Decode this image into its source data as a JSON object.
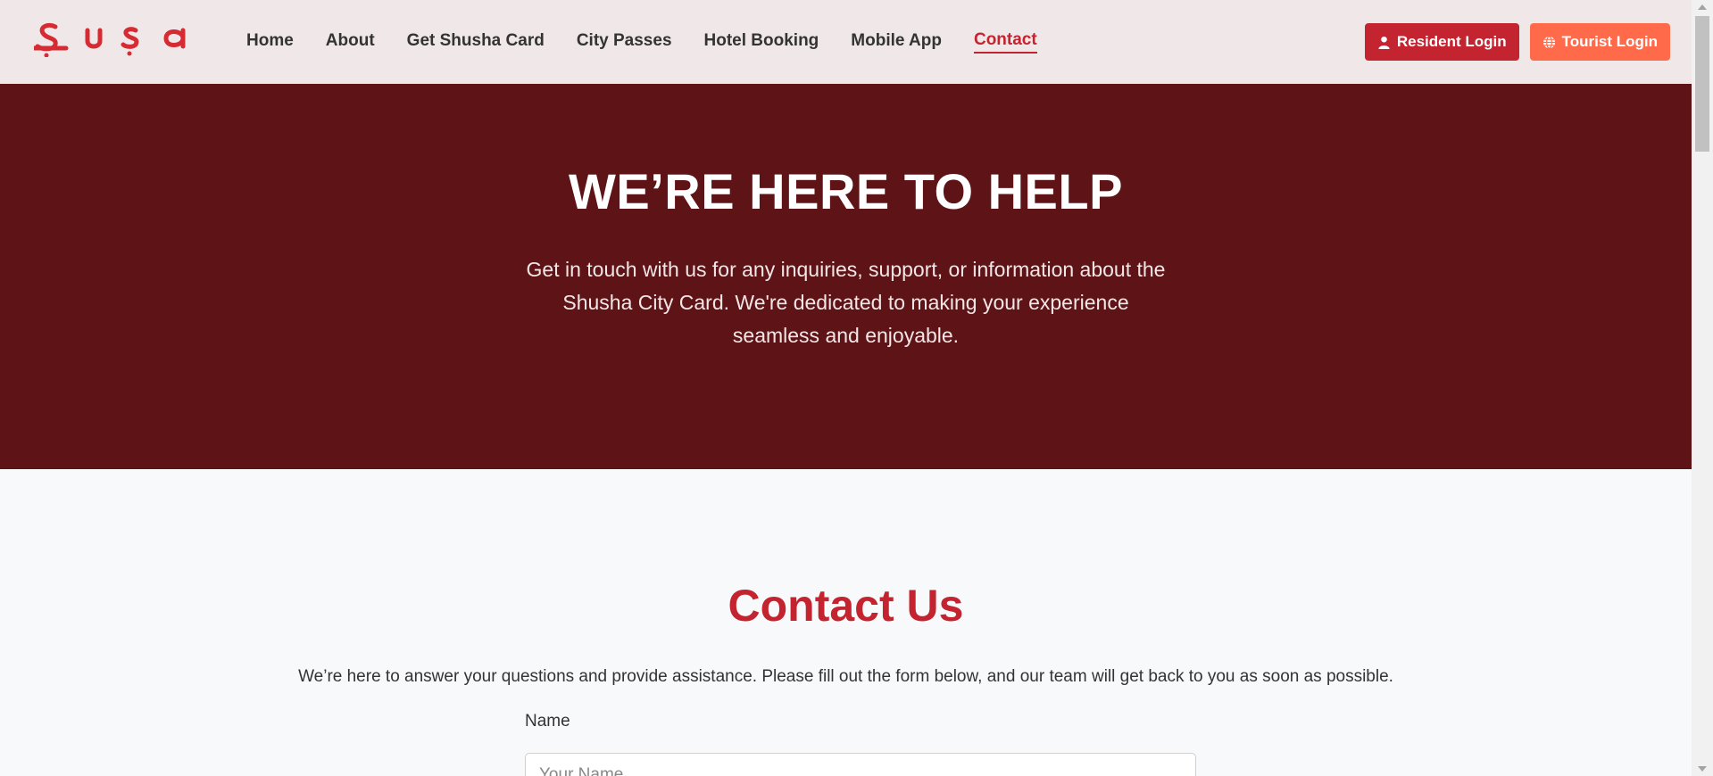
{
  "brand": {
    "logo_text": "Şuşa",
    "color": "#d62b33"
  },
  "nav": {
    "items": [
      {
        "label": "Home",
        "active": false
      },
      {
        "label": "About",
        "active": false
      },
      {
        "label": "Get Shusha Card",
        "active": false
      },
      {
        "label": "City Passes",
        "active": false
      },
      {
        "label": "Hotel Booking",
        "active": false
      },
      {
        "label": "Mobile App",
        "active": false
      },
      {
        "label": "Contact",
        "active": true
      }
    ],
    "resident_login": "Resident Login",
    "tourist_login": "Tourist Login"
  },
  "hero": {
    "title": "WE’RE HERE TO HELP",
    "text": "Get in touch with us for any inquiries, support, or information about the Shusha City Card. We're dedicated to making your experience seamless and enjoyable."
  },
  "contact": {
    "title": "Contact Us",
    "description": "We’re here to answer your questions and provide assistance. Please fill out the form below, and our team will get back to you as soon as possible.",
    "name_label": "Name",
    "name_placeholder": "Your Name",
    "name_value": ""
  },
  "colors": {
    "accent": "#c4242f",
    "tourist": "#ff6b4a",
    "hero_bg": "#5e1317",
    "nav_bg": "#f0e8e8"
  },
  "icons": {
    "resident": "user-icon",
    "tourist": "globe-icon"
  }
}
